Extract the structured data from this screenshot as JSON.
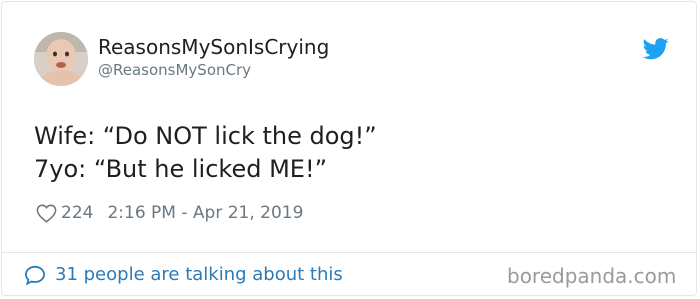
{
  "user": {
    "display_name": "ReasonsMySonIsCrying",
    "handle": "@ReasonsMySonCry",
    "avatar_icon": "baby-avatar"
  },
  "tweet": {
    "lines": [
      "Wife: “Do NOT lick the dog!”",
      "7yo: “But he licked ME!”"
    ],
    "like_count": "224",
    "timestamp": "2:16 PM - Apr 21, 2019"
  },
  "footer": {
    "talking_text": "31 people are talking about this",
    "watermark": "boredpanda.com"
  },
  "colors": {
    "twitter_blue": "#1da1f2",
    "link_blue": "#2b7bb9",
    "meta_gray": "#697882",
    "border": "#e1e8ed"
  },
  "icons": {
    "brand": "twitter-bird-icon",
    "like": "heart-icon",
    "reply": "speech-bubble-icon"
  }
}
